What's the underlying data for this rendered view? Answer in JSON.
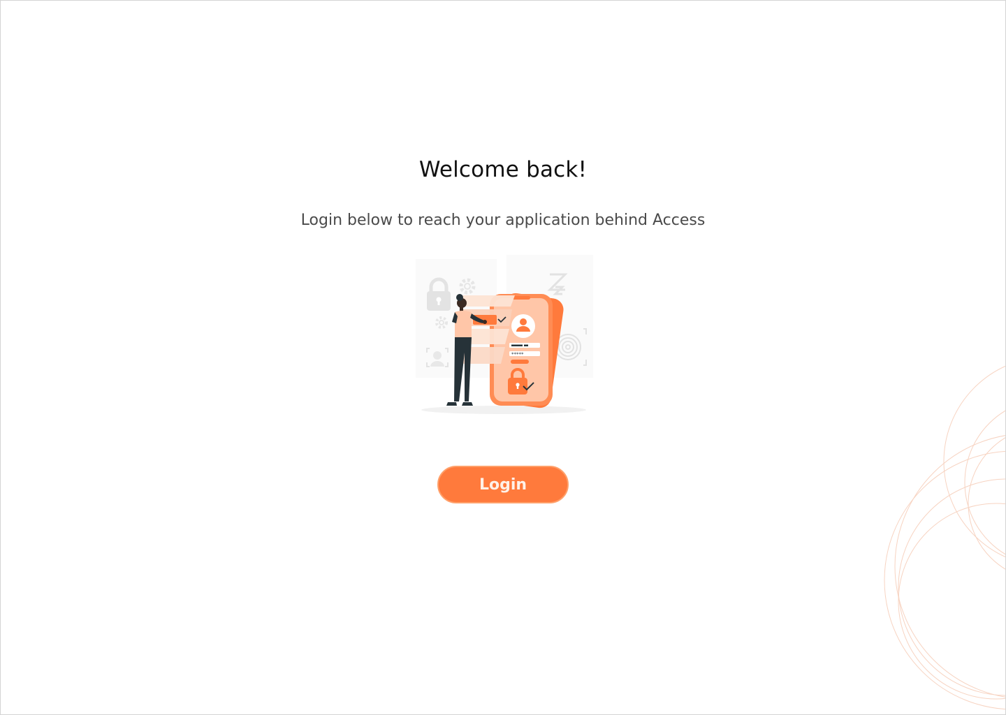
{
  "page": {
    "title": "Welcome back!",
    "subtitle": "Login below to reach your application behind Access"
  },
  "actions": {
    "login_label": "Login"
  },
  "illustration": {
    "icon": "mobile-login-illustration",
    "masked_password": "*****"
  },
  "colors": {
    "accent": "#ff7a3c",
    "accent_light": "#ffa06a",
    "accent_pale": "#fcd9c6",
    "ink": "#263238"
  }
}
